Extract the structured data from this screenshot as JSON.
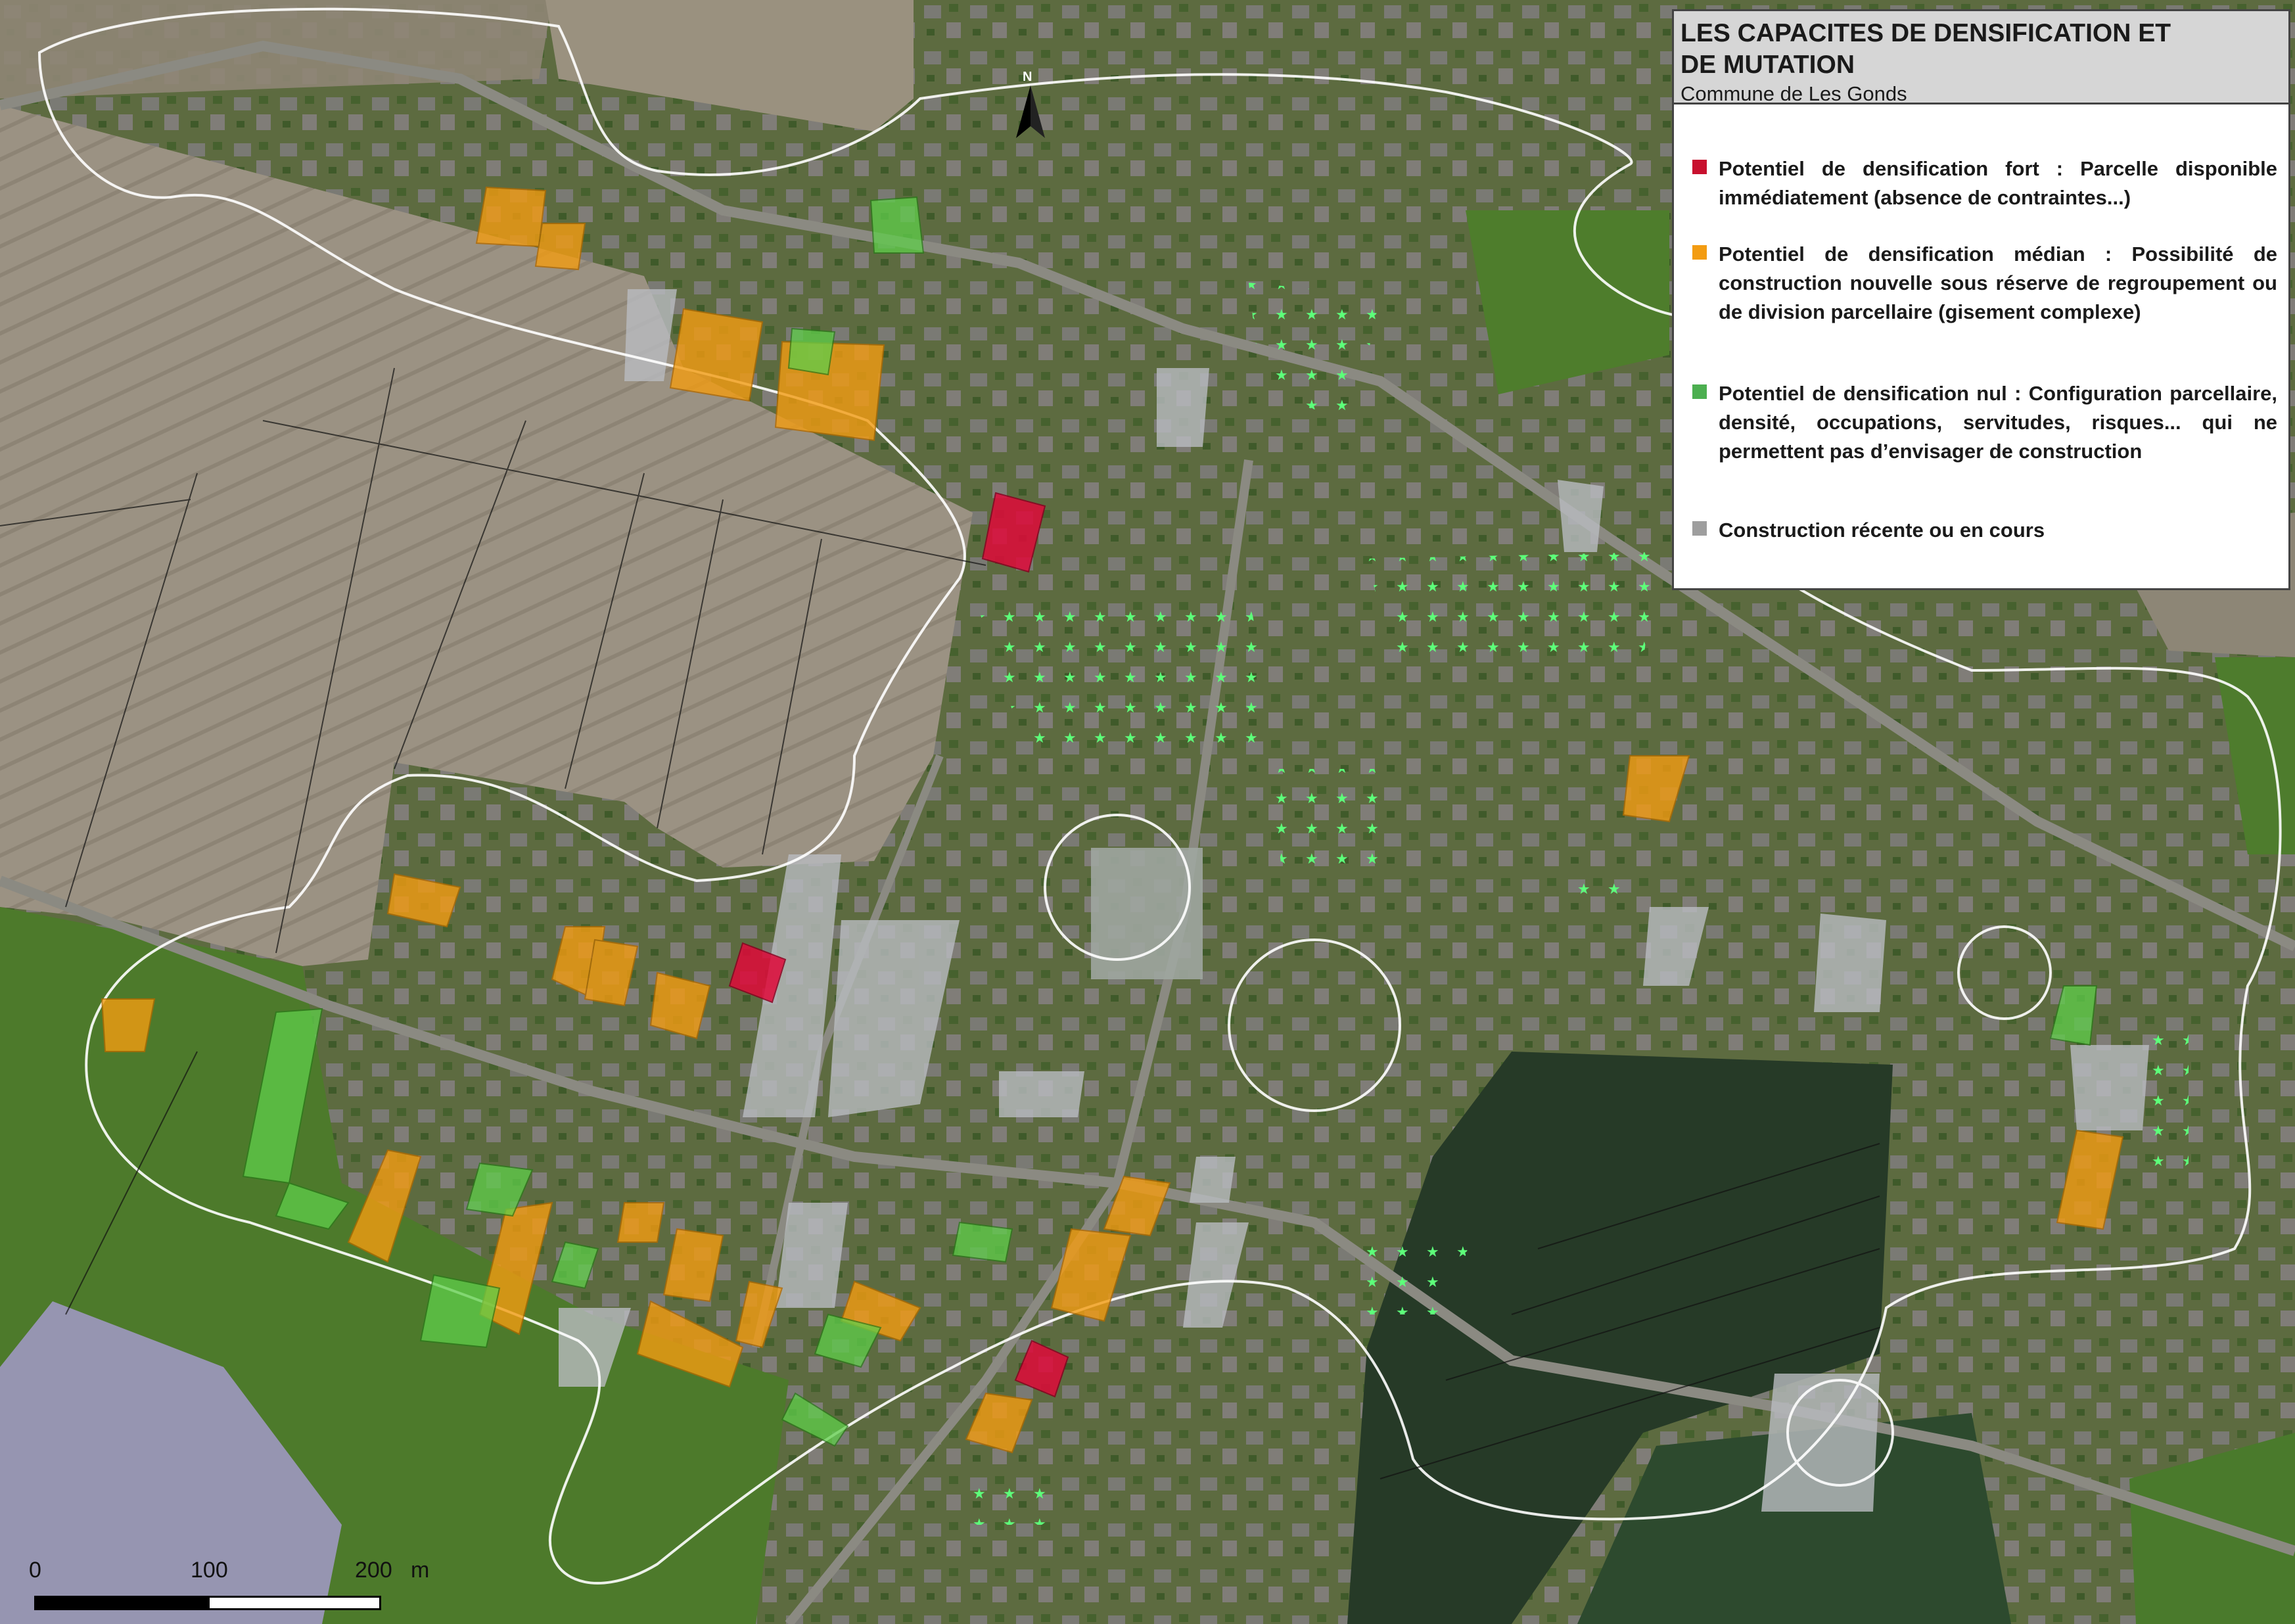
{
  "legend": {
    "title": "LES CAPACITES DE DENSIFICATION ET\nDE MUTATION",
    "subtitle": "Commune de Les Gonds",
    "items": [
      {
        "color": "#c8102e",
        "label": "Potentiel de densification fort : Parcelle disponible immédiatement (absence de contraintes...)"
      },
      {
        "color": "#f39c12",
        "label": "Potentiel de densification médian : Possibilité de construction nouvelle sous réserve de regroupement ou de division parcellaire (gisement complexe)"
      },
      {
        "color": "#4caf50",
        "label": "Potentiel de densification nul : Configuration parcellaire, densité, occupations, servitudes, risques... qui ne permettent pas d’envisager de construction"
      },
      {
        "color": "#9e9e9e",
        "label": "Construction récente ou en cours"
      }
    ]
  },
  "north_arrow": {
    "label": "N"
  },
  "scale": {
    "labels": [
      "0",
      "100",
      "200",
      "m"
    ]
  },
  "colors": {
    "strong": "#c8102e",
    "median": "#f39c12",
    "none": "#4caf50",
    "recent": "#9e9e9e",
    "field_light": "#9a8f7f",
    "field_green": "#4c6a2a",
    "field_dark": "#2b3a26",
    "urban": "#6b7352",
    "road": "#8a8a82"
  }
}
